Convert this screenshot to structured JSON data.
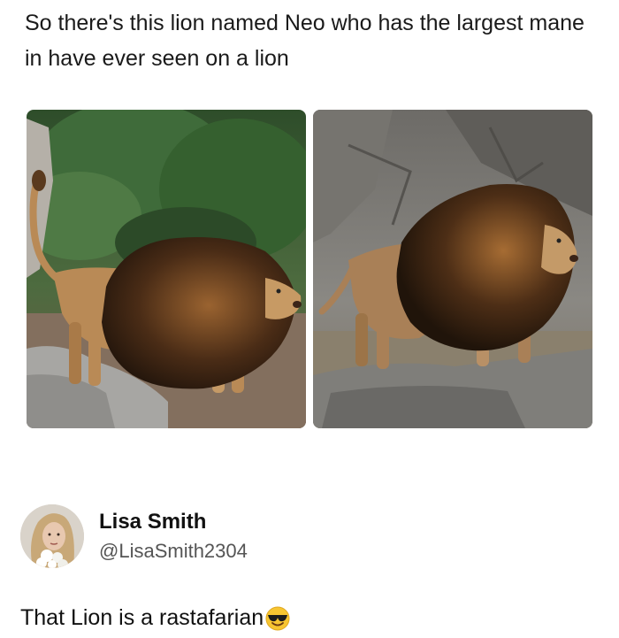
{
  "post": {
    "text": "So there's this lion named Neo who has the largest mane in have ever seen on a lion"
  },
  "photos": [
    {
      "icon": "lion-photo-left"
    },
    {
      "icon": "lion-photo-right"
    }
  ],
  "reply": {
    "user_name": "Lisa Smith",
    "user_handle": "@LisaSmith2304",
    "text": "That Lion is a rastafarian",
    "emoji": "smiling-face-with-sunglasses-icon"
  },
  "colors": {
    "mane_dark": "#3a2414",
    "mane_light": "#8a5a2c",
    "fur": "#b98a56",
    "rock": "#8c8c8c",
    "foliage": "#3f6b3a"
  }
}
